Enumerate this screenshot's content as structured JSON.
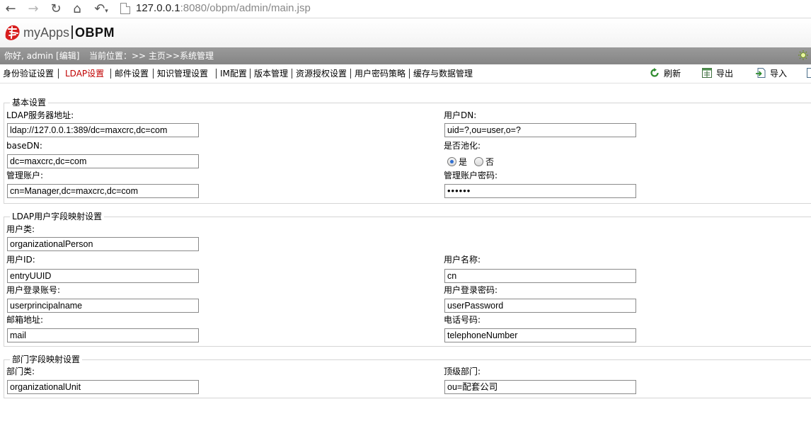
{
  "browser": {
    "url_host": "127.0.0.1",
    "url_rest": ":8080/obpm/admin/main.jsp"
  },
  "header": {
    "logo_left": "myApps",
    "logo_right": "OBPM"
  },
  "status": {
    "greeting": "你好, admin [编辑]",
    "location": "当前位置：>> 主页>>系统管理"
  },
  "tabs": [
    {
      "label": "身份验证设置"
    },
    {
      "label": "LDAP设置"
    },
    {
      "label": "邮件设置"
    },
    {
      "label": "知识管理设置"
    },
    {
      "label": "IM配置"
    },
    {
      "label": "版本管理"
    },
    {
      "label": "资源授权设置"
    },
    {
      "label": "用户密码策略"
    },
    {
      "label": "缓存与数据管理"
    }
  ],
  "toolbar": {
    "refresh": "刷新",
    "export": "导出",
    "import": "导入"
  },
  "basic": {
    "legend": "基本设置",
    "server_label": "LDAP服务器地址:",
    "server_value": "ldap://127.0.0.1:389/dc=maxcrc,dc=com",
    "user_dn_label": "用户DN:",
    "user_dn_value": "uid=?,ou=user,o=?",
    "base_dn_label": "baseDN:",
    "base_dn_value": "dc=maxcrc,dc=com",
    "pool_label": "是否池化:",
    "pool_yes": "是",
    "pool_no": "否",
    "pool_selected": "是",
    "admin_label": "管理账户:",
    "admin_value": "cn=Manager,dc=maxcrc,dc=com",
    "admin_pwd_label": "管理账户密码:",
    "admin_pwd_value": "••••••"
  },
  "user_map": {
    "legend": "LDAP用户字段映射设置",
    "class_label": "用户类:",
    "class_value": "organizationalPerson",
    "id_label": "用户ID:",
    "id_value": "entryUUID",
    "name_label": "用户名称:",
    "name_value": "cn",
    "login_label": "用户登录账号:",
    "login_value": "userprincipalname",
    "login_pwd_label": "用户登录密码:",
    "login_pwd_value": "userPassword",
    "mail_label": "邮箱地址:",
    "mail_value": "mail",
    "phone_label": "电话号码:",
    "phone_value": "telephoneNumber"
  },
  "dept_map": {
    "legend": "部门字段映射设置",
    "class_label": "部门类:",
    "class_value": "organizationalUnit",
    "top_label": "顶级部门:",
    "top_value": "ou=配套公司"
  },
  "colors": {
    "active_tab": "#c00000",
    "status_bar": "#8e8e8e",
    "radio_dot": "#2f6fd1"
  }
}
